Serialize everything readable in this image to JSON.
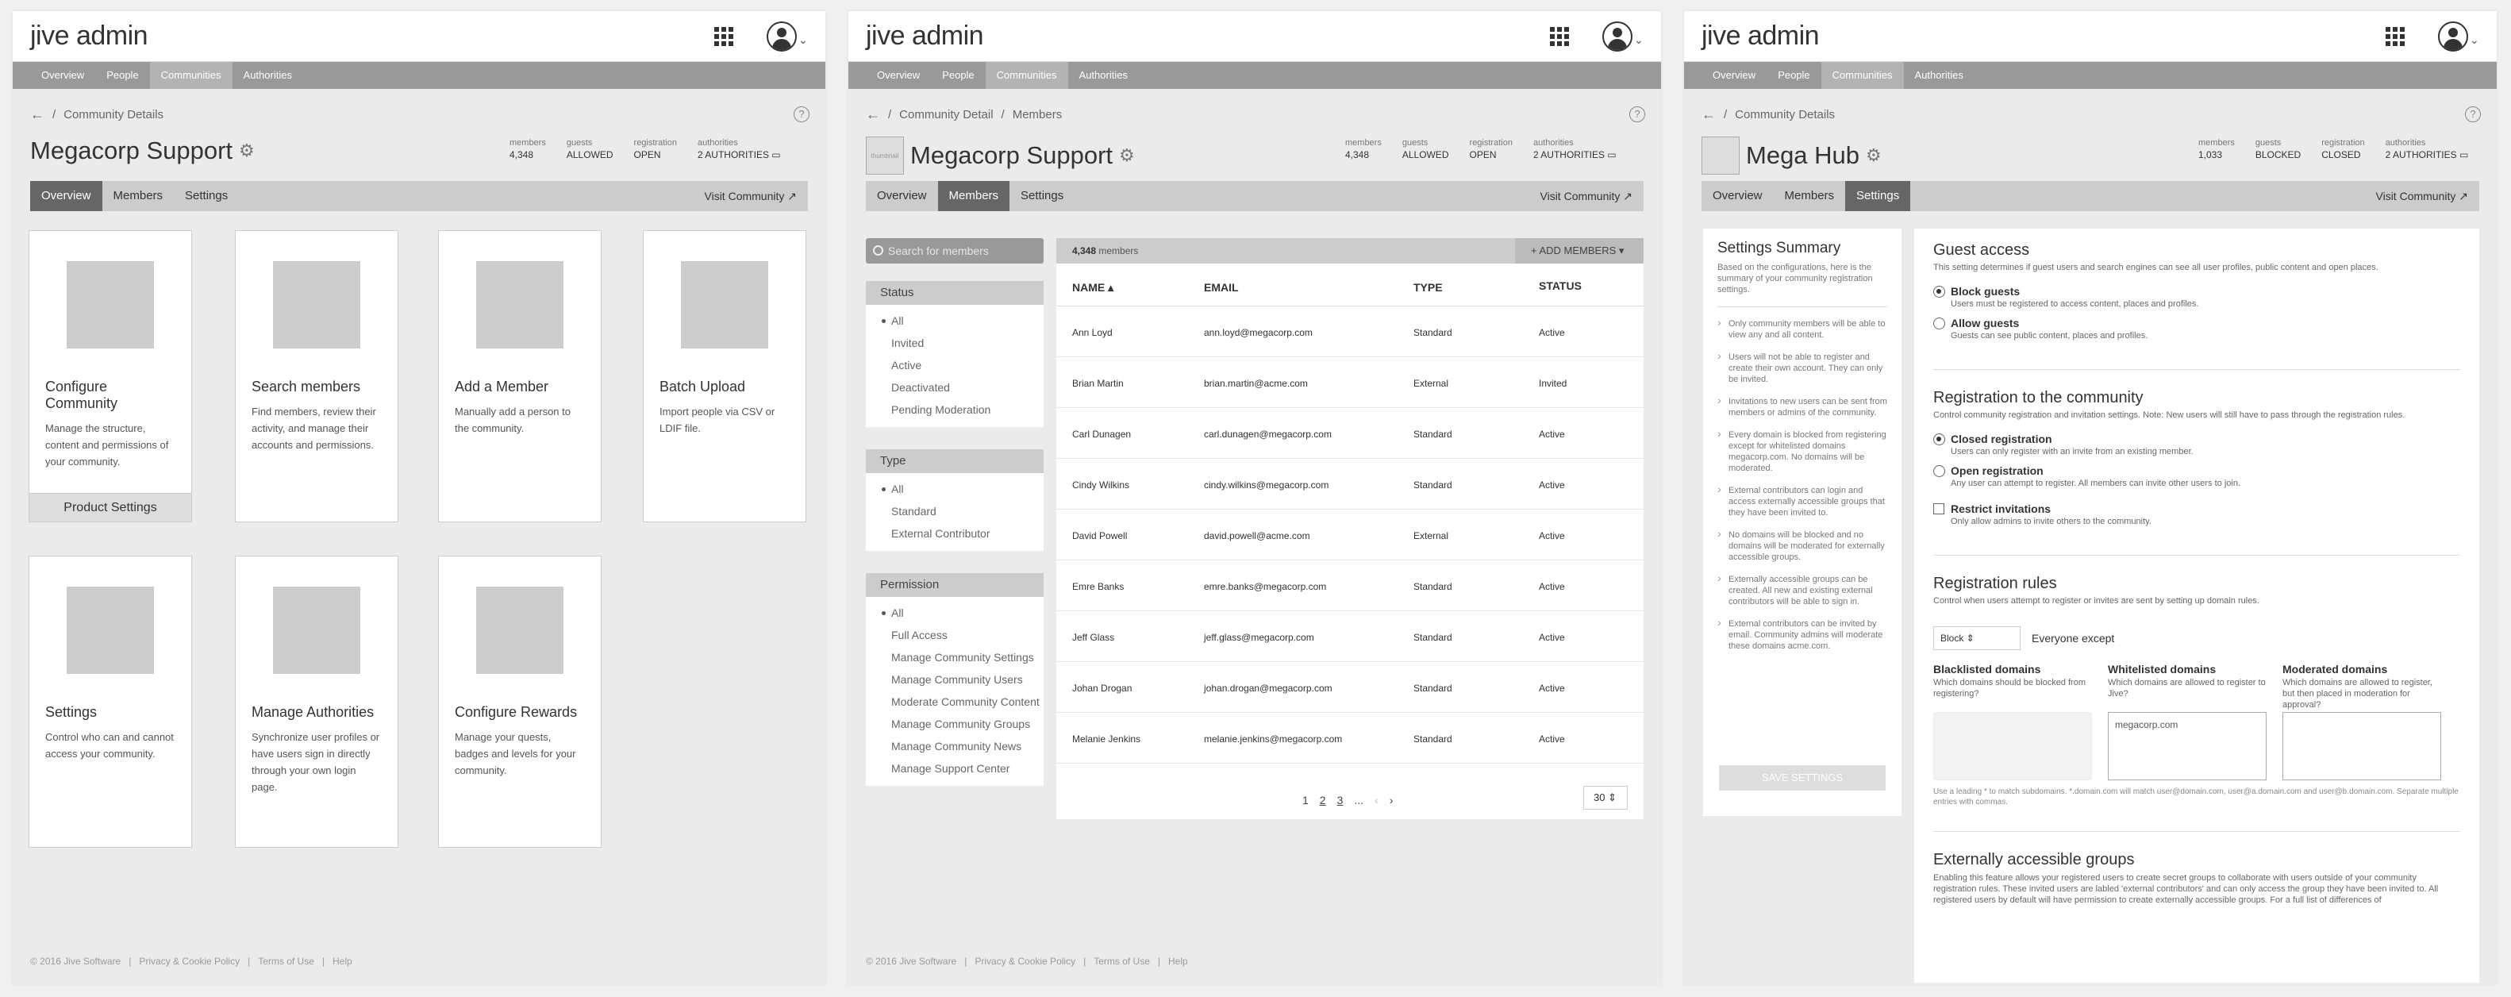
{
  "app": {
    "brand": "jive admin"
  },
  "nav": [
    "Overview",
    "People",
    "Communities",
    "Authorities"
  ],
  "subnav": {
    "overview": "Overview",
    "members": "Members",
    "settings": "Settings",
    "visit": "Visit Community ↗"
  },
  "footer": {
    "copy": "© 2016 Jive Software",
    "privacy": "Privacy & Cookie Policy",
    "terms": "Terms of Use",
    "help": "Help"
  },
  "stat_keys": {
    "members": "members",
    "guests": "guests",
    "registration": "registration",
    "authorities": "authorities"
  },
  "panel1": {
    "breadcrumb": [
      "←",
      "/",
      "Community Details"
    ],
    "title": "Megacorp Support",
    "stats": {
      "members": "4,348",
      "guests": "ALLOWED",
      "registration": "OPEN",
      "authorities": "2 AUTHORITIES ▭"
    },
    "cards": [
      {
        "title": "Configure Community",
        "desc": "Manage the structure, content and permissions of your community.",
        "footer": "Product Settings"
      },
      {
        "title": "Search members",
        "desc": "Find members, review their activity, and manage their accounts and permissions."
      },
      {
        "title": "Add a Member",
        "desc": "Manually add a person to the community."
      },
      {
        "title": "Batch Upload",
        "desc": "Import people via CSV or LDIF file."
      },
      {
        "title": "Settings",
        "desc": "Control who can and cannot access your community."
      },
      {
        "title": "Manage Authorities",
        "desc": "Synchronize user profiles or have users sign in directly through your own login page."
      },
      {
        "title": "Configure Rewards",
        "desc": "Manage your quests, badges and levels for your community."
      }
    ]
  },
  "panel2": {
    "breadcrumb": [
      "←",
      "/",
      "Community Detail",
      "/",
      "Members"
    ],
    "thumb_label": "thumbnail",
    "title": "Megacorp Support",
    "stats": {
      "members": "4,348",
      "guests": "ALLOWED",
      "registration": "OPEN",
      "authorities": "2 AUTHORITIES ▭"
    },
    "search_placeholder": "Search for members",
    "filters": {
      "status": {
        "title": "Status",
        "items": [
          "All",
          "Invited",
          "Active",
          "Deactivated",
          "Pending Moderation"
        ]
      },
      "type": {
        "title": "Type",
        "items": [
          "All",
          "Standard",
          "External Contributor"
        ]
      },
      "permission": {
        "title": "Permission",
        "items": [
          "All",
          "Full Access",
          "Manage Community Settings",
          "Manage Community Users",
          "Moderate Community Content",
          "Manage Community Groups",
          "Manage Community News",
          "Manage Support Center"
        ]
      }
    },
    "count": "4,348",
    "count_label": "members",
    "add_button": "+ ADD MEMBERS ▾",
    "columns": {
      "name": "NAME ▴",
      "email": "EMAIL",
      "type": "TYPE",
      "status": "STATUS"
    },
    "rows": [
      {
        "name": "Ann Loyd",
        "email": "ann.loyd@megacorp.com",
        "type": "Standard",
        "status": "Active"
      },
      {
        "name": "Brian Martin",
        "email": "brian.martin@acme.com",
        "type": "External",
        "status": "Invited"
      },
      {
        "name": "Carl Dunagen",
        "email": "carl.dunagen@megacorp.com",
        "type": "Standard",
        "status": "Active"
      },
      {
        "name": "Cindy Wilkins",
        "email": "cindy.wilkins@megacorp.com",
        "type": "Standard",
        "status": "Active"
      },
      {
        "name": "David Powell",
        "email": "david.powell@acme.com",
        "type": "External",
        "status": "Active"
      },
      {
        "name": "Emre Banks",
        "email": "emre.banks@megacorp.com",
        "type": "Standard",
        "status": "Active"
      },
      {
        "name": "Jeff Glass",
        "email": "jeff.glass@megacorp.com",
        "type": "Standard",
        "status": "Active"
      },
      {
        "name": "Johan Drogan",
        "email": "johan.drogan@megacorp.com",
        "type": "Standard",
        "status": "Active"
      },
      {
        "name": "Melanie Jenkins",
        "email": "melanie.jenkins@megacorp.com",
        "type": "Standard",
        "status": "Active"
      }
    ],
    "pager": [
      "1",
      "2",
      "3",
      "...",
      "‹",
      "›"
    ],
    "per_page": "30 ⇕"
  },
  "panel3": {
    "breadcrumb": [
      "←",
      "/",
      "Community Details"
    ],
    "title": "Mega Hub",
    "stats": {
      "members": "1,033",
      "guests": "BLOCKED",
      "registration": "CLOSED",
      "authorities": "2 AUTHORITIES ▭"
    },
    "summary": {
      "title": "Settings Summary",
      "desc": "Based on the configurations, here is the summary of your community registration settings.",
      "items": [
        "Only community members will be able to view any and all content.",
        "Users will not be able to register and create their own account. They can only be invited.",
        "Invitations to new users can be sent from members or admins of the community.",
        "Every domain is blocked from registering except for whitelisted domains megacorp.com. No domains will be moderated.",
        "External contributors can login and access externally accessible groups that they have been invited to.",
        "No domains will be blocked and no domains will be moderated for externally accessible groups.",
        "Externally accessible groups can be created. All new and existing external contributors will be able to sign in.",
        "External contributors can be invited by email. Community admins will moderate these domains acme.com."
      ],
      "save": "SAVE SETTINGS"
    },
    "guest": {
      "title": "Guest access",
      "desc": "This setting determines if guest users and search engines can see all user profiles, public content and open places.",
      "opt1_t": "Block guests",
      "opt1_d": "Users must be registered to access content, places and profiles.",
      "opt2_t": "Allow guests",
      "opt2_d": "Guests can see public content, places and profiles."
    },
    "reg": {
      "title": "Registration to the community",
      "desc": "Control community registration and invitation settings.  Note: New users will still have to pass through the registration rules.",
      "opt1_t": "Closed registration",
      "opt1_d": "Users can only register with an invite from an existing member.",
      "opt2_t": "Open registration",
      "opt2_d": "Any user can attempt to register. All members can invite other users to join.",
      "opt3_t": "Restrict invitations",
      "opt3_d": "Only allow admins to invite others to the community."
    },
    "rules": {
      "title": "Registration rules",
      "desc": "Control when users attempt to register or invites are sent by setting up domain rules.",
      "select": "Block ⇕",
      "except": "Everyone except",
      "black_t": "Blacklisted domains",
      "black_d": "Which domains should be blocked from registering?",
      "white_t": "Whitelisted domains",
      "white_d": "Which domains are allowed to register to Jive?",
      "white_v": "megacorp.com",
      "mod_t": "Moderated domains",
      "mod_d": "Which domains are allowed to register, but then placed in moderation for approval?",
      "hint": "Use a leading * to match subdomains. *.domain.com will match user@domain.com, user@a.domain.com and user@b.domain.com. Separate multiple entries with commas."
    },
    "ext": {
      "title": "Externally accessible groups",
      "desc": "Enabling this feature allows your registered users to create secret groups to collaborate with users outside of your community registration rules. These invited users are labled 'external contributors' and can only access the group they have been invited to.  All registered users by default will have permission to create externally accessible groups. For a full list of differences of"
    }
  }
}
